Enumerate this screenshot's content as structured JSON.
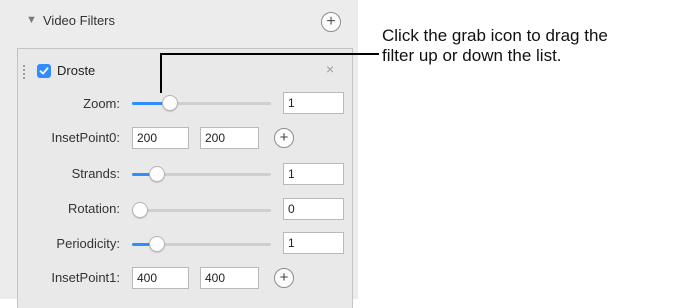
{
  "panel": {
    "section_title": "Video Filters",
    "disclosure_glyph": "▼",
    "add_glyph": "+"
  },
  "filter": {
    "name": "Droste",
    "enabled": true,
    "remove_glyph": "×",
    "params": {
      "zoom": {
        "label": "Zoom:",
        "value": "1",
        "slider_level": 0.24
      },
      "insetpoint0": {
        "label": "InsetPoint0:",
        "x": "200",
        "y": "200",
        "plus_glyph": "+"
      },
      "strands": {
        "label": "Strands:",
        "value": "1",
        "slider_level": 0.14
      },
      "rotation": {
        "label": "Rotation:",
        "value": "0",
        "slider_level": 0.0
      },
      "periodicity": {
        "label": "Periodicity:",
        "value": "1",
        "slider_level": 0.14
      },
      "insetpoint1": {
        "label": "InsetPoint1:",
        "x": "400",
        "y": "400",
        "plus_glyph": "+"
      }
    }
  },
  "callout": {
    "line1": "Click the grab icon to drag the",
    "line2": "filter up or down the list."
  },
  "colors": {
    "accent": "#2f8dff",
    "panel_bg": "#ececec",
    "filter_bg": "#e9e9e9"
  }
}
